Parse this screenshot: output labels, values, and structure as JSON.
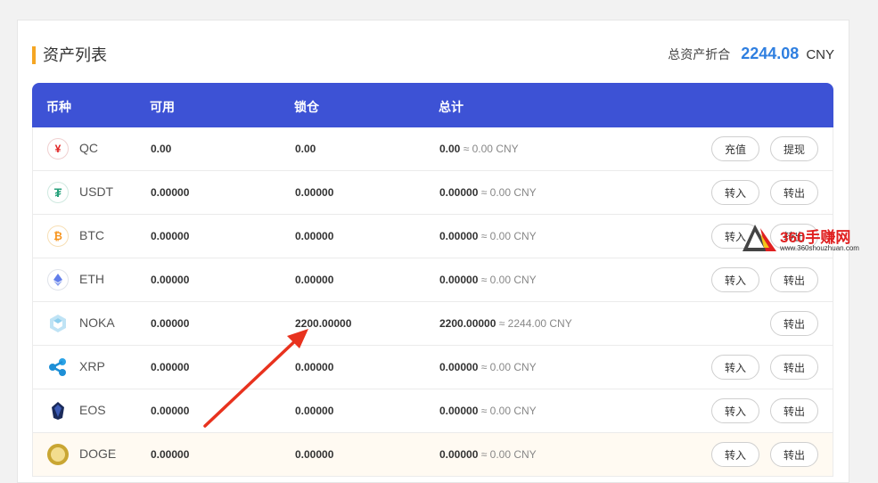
{
  "header": {
    "title": "资产列表",
    "total_label": "总资产折合",
    "total_value": "2244.08",
    "total_currency": "CNY"
  },
  "table": {
    "columns": [
      "币种",
      "可用",
      "锁仓",
      "总计"
    ],
    "rows": [
      {
        "coin": "QC",
        "icon": "yen-icon",
        "available": "0.00",
        "locked": "0.00",
        "total": "0.00",
        "approx": "≈ 0.00 CNY",
        "btn1": "充值",
        "btn2": "提现"
      },
      {
        "coin": "USDT",
        "icon": "tether-icon",
        "available": "0.00000",
        "locked": "0.00000",
        "total": "0.00000",
        "approx": "≈ 0.00 CNY",
        "btn1": "转入",
        "btn2": "转出"
      },
      {
        "coin": "BTC",
        "icon": "bitcoin-icon",
        "available": "0.00000",
        "locked": "0.00000",
        "total": "0.00000",
        "approx": "≈ 0.00 CNY",
        "btn1": "转入",
        "btn2": "转出"
      },
      {
        "coin": "ETH",
        "icon": "ethereum-icon",
        "available": "0.00000",
        "locked": "0.00000",
        "total": "0.00000",
        "approx": "≈ 0.00 CNY",
        "btn1": "转入",
        "btn2": "转出"
      },
      {
        "coin": "NOKA",
        "icon": "noka-icon",
        "available": "0.00000",
        "locked": "2200.00000",
        "total": "2200.00000",
        "approx": "≈ 2244.00 CNY",
        "btn1": "",
        "btn2": "转出"
      },
      {
        "coin": "XRP",
        "icon": "ripple-icon",
        "available": "0.00000",
        "locked": "0.00000",
        "total": "0.00000",
        "approx": "≈ 0.00 CNY",
        "btn1": "转入",
        "btn2": "转出"
      },
      {
        "coin": "EOS",
        "icon": "eos-icon",
        "available": "0.00000",
        "locked": "0.00000",
        "total": "0.00000",
        "approx": "≈ 0.00 CNY",
        "btn1": "转入",
        "btn2": "转出"
      },
      {
        "coin": "DOGE",
        "icon": "dogecoin-icon",
        "available": "0.00000",
        "locked": "0.00000",
        "total": "0.00000",
        "approx": "≈ 0.00 CNY",
        "btn1": "转入",
        "btn2": "转出"
      }
    ]
  },
  "watermark": {
    "text": "360手赚网",
    "url": "www.360shouzhuan.com"
  },
  "colors": {
    "header_bg": "#3d52d5",
    "accent": "#f5a623",
    "total_value": "#2f7fe0",
    "arrow": "#e8321e"
  }
}
